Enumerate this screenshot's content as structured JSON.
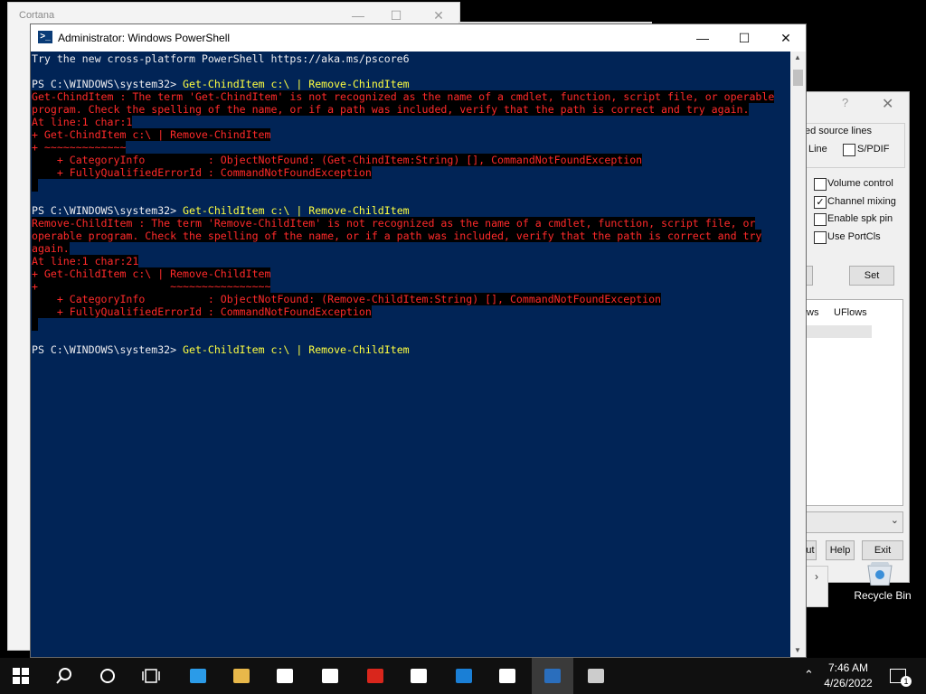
{
  "cortana": {
    "title": "Cortana"
  },
  "powershell": {
    "title": "Administrator: Windows PowerShell",
    "lines": [
      {
        "t": "Try the new cross-platform PowerShell https://aka.ms/pscore6",
        "k": "plain"
      },
      {
        "t": "",
        "k": "plain"
      },
      {
        "p": "PS C:\\WINDOWS\\system32> ",
        "t": "Get-ChindItem c:\\ | Remove-ChindItem",
        "k": "cmd"
      },
      {
        "t": "Get-ChindItem : The term 'Get-ChindItem' is not recognized as the name of a cmdlet, function, script file, or operable",
        "k": "err"
      },
      {
        "t": "program. Check the spelling of the name, or if a path was included, verify that the path is correct and try again.",
        "k": "err"
      },
      {
        "t": "At line:1 char:1",
        "k": "err"
      },
      {
        "t": "+ Get-ChindItem c:\\ | Remove-ChindItem",
        "k": "err"
      },
      {
        "t": "+ ~~~~~~~~~~~~~",
        "k": "err"
      },
      {
        "t": "    + CategoryInfo          : ObjectNotFound: (Get-ChindItem:String) [], CommandNotFoundException",
        "k": "err"
      },
      {
        "t": "    + FullyQualifiedErrorId : CommandNotFoundException",
        "k": "err"
      },
      {
        "t": " ",
        "k": "err"
      },
      {
        "t": "",
        "k": "plain"
      },
      {
        "p": "PS C:\\WINDOWS\\system32> ",
        "t": "Get-ChildItem c:\\ | Remove-ChildItem",
        "k": "cmd"
      },
      {
        "t": "Remove-ChildItem : The term 'Remove-ChildItem' is not recognized as the name of a cmdlet, function, script file, or",
        "k": "err"
      },
      {
        "t": "operable program. Check the spelling of the name, or if a path was included, verify that the path is correct and try",
        "k": "err"
      },
      {
        "t": "again.",
        "k": "err"
      },
      {
        "t": "At line:1 char:21",
        "k": "err"
      },
      {
        "t": "+ Get-ChildItem c:\\ | Remove-ChildItem",
        "k": "err"
      },
      {
        "t": "+                     ~~~~~~~~~~~~~~~~",
        "k": "err"
      },
      {
        "t": "    + CategoryInfo          : ObjectNotFound: (Remove-ChildItem:String) [], CommandNotFoundException",
        "k": "err"
      },
      {
        "t": "    + FullyQualifiedErrorId : CommandNotFoundException",
        "k": "err"
      },
      {
        "t": " ",
        "k": "err"
      },
      {
        "t": "",
        "k": "plain"
      },
      {
        "p": "PS C:\\WINDOWS\\system32> ",
        "t": "Get-ChildItem c:\\ | Remove-ChildItem",
        "k": "cmd"
      }
    ]
  },
  "dialog": {
    "help": "?",
    "group_label": "ed source lines",
    "line_label": "Line",
    "spdif_label": "S/PDIF",
    "options": [
      {
        "label": "Volume control",
        "checked": false
      },
      {
        "label": "Channel mixing",
        "checked": true
      },
      {
        "label": "Enable spk pin",
        "checked": false
      },
      {
        "label": "Use PortCls",
        "checked": false
      }
    ],
    "set_button": "Set",
    "list_headers": [
      "ws",
      "UFlows"
    ],
    "out_button": "ut",
    "help_button": "Help",
    "exit_button": "Exit"
  },
  "desktop": {
    "recycle_bin": "Recycle Bin"
  },
  "taskbar": {
    "time": "7:46 AM",
    "date": "4/26/2022",
    "notifications": "1",
    "icons": [
      "windows-start-icon",
      "search-icon",
      "cortana-icon",
      "task-view-icon",
      "edge-icon",
      "file-explorer-icon",
      "store-icon",
      "mail-icon",
      "acrobat-icon",
      "7zip-icon",
      "network-tool-icon",
      "calendar-icon",
      "powershell-icon",
      "app-window-icon"
    ]
  },
  "colors": {
    "console_bg": "#012456",
    "error_fg": "#ff2a2a",
    "command_fg": "#ffff40"
  }
}
